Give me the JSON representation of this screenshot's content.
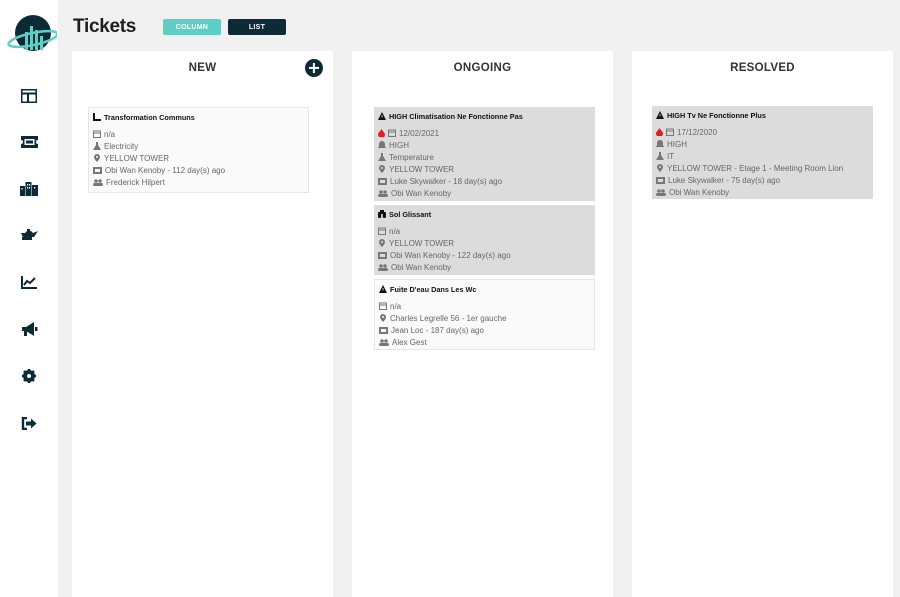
{
  "header": {
    "title": "Tickets",
    "view_column": "COLUMN",
    "view_list": "LIST"
  },
  "sidebar": {
    "items": [
      {
        "icon": "dashboard-icon"
      },
      {
        "icon": "ticket-icon"
      },
      {
        "icon": "buildings-icon"
      },
      {
        "icon": "oil-can-icon"
      },
      {
        "icon": "chart-line-icon"
      },
      {
        "icon": "megaphone-icon"
      },
      {
        "icon": "gear-icon"
      },
      {
        "icon": "sign-out-icon"
      }
    ]
  },
  "columns": {
    "new": {
      "title": "NEW",
      "cards": [
        {
          "title": "Transformation Communs",
          "date": "n/a",
          "category": "Electricity",
          "location": "YELLOW TOWER",
          "reporter": "Obi Wan Kenoby - 112 day(s) ago",
          "assignee": "Frederick Hilpert"
        }
      ]
    },
    "ongoing": {
      "title": "ONGOING",
      "cards": [
        {
          "title": "HIGH Climatisation Ne Fonctionne Pas",
          "date": "12/02/2021",
          "priority": "HIGH",
          "category": "Temperature",
          "location": "YELLOW TOWER",
          "reporter": "Luke Skywalker - 18 day(s) ago",
          "assignee": "Obi Wan Kenoby"
        },
        {
          "title": "Sol Glissant",
          "date": "n/a",
          "location": "YELLOW TOWER",
          "reporter": "Obi Wan Kenoby - 122 day(s) ago",
          "assignee": "Obi Wan Kenoby"
        },
        {
          "title": "Fuite D'eau Dans Les Wc",
          "date": "n/a",
          "location": "Charles Legrelle 56 - 1er gauche",
          "reporter": "Jean Loc - 187 day(s) ago",
          "assignee": "Alex Gest"
        }
      ]
    },
    "resolved": {
      "title": "RESOLVED",
      "cards": [
        {
          "title": "HIGH Tv Ne Fonctionne Plus",
          "date": "17/12/2020",
          "priority": "HIGH",
          "category": "IT",
          "location": "YELLOW TOWER - Etage 1 - Meeting Room Lion",
          "reporter": "Luke Skywalker - 75 day(s) ago",
          "assignee": "Obi Wan Kenoby"
        }
      ]
    }
  },
  "colors": {
    "accent_teal": "#5ecfc5",
    "navy": "#0d2b37",
    "urgent_red": "#e02020",
    "card_active": "#dcdcdc"
  }
}
